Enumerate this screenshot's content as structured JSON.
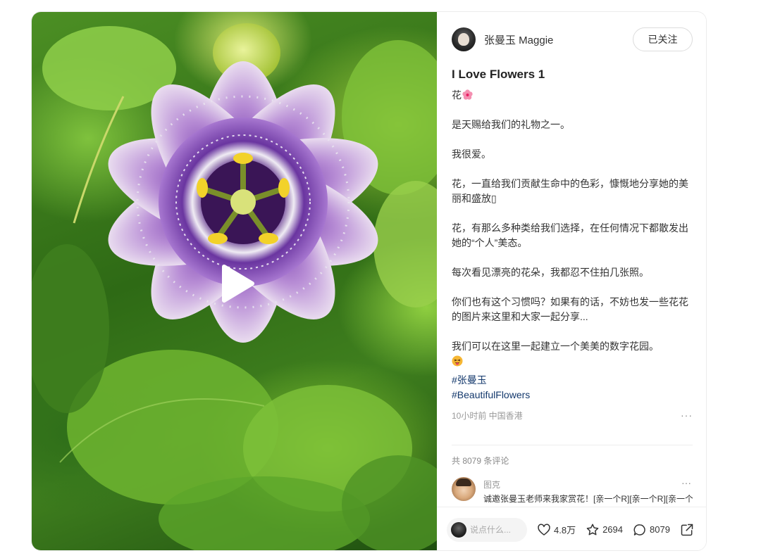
{
  "author": {
    "name": "张曼玉 Maggie",
    "follow_label": "已关注"
  },
  "post": {
    "title": "I Love Flowers 1",
    "first_line": "花",
    "paragraphs": [
      "是天赐给我们的礼物之一。",
      "我很爱。",
      "花，一直给我们贡献生命中的色彩，慷慨地分享她的美丽和盛放▯",
      "花，有那么多种类给我们选择，在任何情况下都散发出她的“个人”美态。",
      "每次看见漂亮的花朵，我都忍不住拍几张照。",
      "你们也有这个习惯吗？如果有的话，不妨也发一些花花的图片来这里和大家一起分享..."
    ],
    "closing": "我们可以在这里一起建立一个美美的数字花园。",
    "tags": [
      "#张曼玉",
      "#BeautifulFlowers"
    ],
    "meta": "10小时前 中国香港",
    "more": "···"
  },
  "comments": {
    "total_label": "共 8079 条评论",
    "items": [
      {
        "user": "图克",
        "text": "诚邀张曼玉老师来我家赏花！[亲一个R][亲一个R][亲一个R]",
        "more": "···"
      }
    ]
  },
  "bottom_bar": {
    "input_placeholder": "说点什么...",
    "likes": "4.8万",
    "stars": "2694",
    "comments": "8079"
  },
  "icons": {
    "play": "play-icon",
    "like": "heart-icon",
    "star": "star-icon",
    "comment": "chat-bubble-icon",
    "share": "share-icon",
    "more": "more-dots-icon"
  },
  "colors": {
    "tag_link": "#13386c",
    "flower_purple": "#7b3fb0",
    "leaf_green": "#4c8f24"
  }
}
